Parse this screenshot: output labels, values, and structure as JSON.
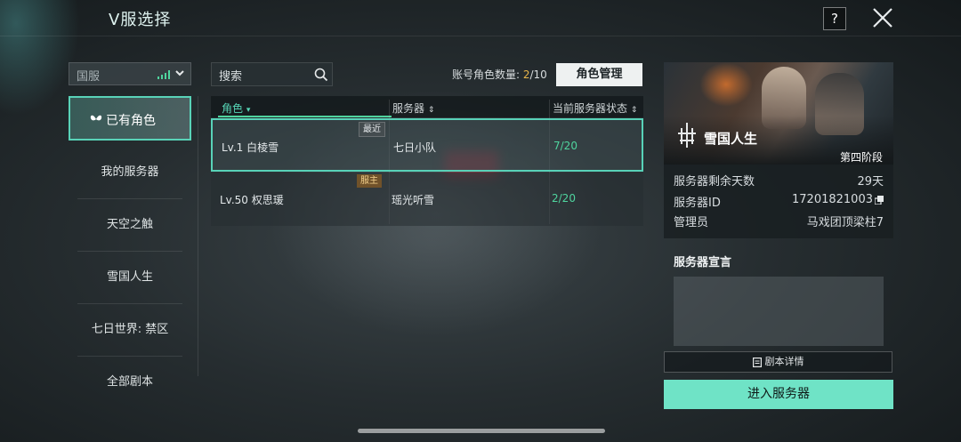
{
  "header": {
    "title": "V服选择",
    "help_label": "?"
  },
  "region_select": {
    "value": "国服"
  },
  "sidebar": {
    "items": [
      {
        "label": "已有角色",
        "selected": true
      },
      {
        "label": "我的服务器"
      },
      {
        "label": "天空之触"
      },
      {
        "label": "雪国人生"
      },
      {
        "label": "七日世界: 禁区"
      },
      {
        "label": "全部剧本"
      }
    ]
  },
  "search": {
    "placeholder": "搜索"
  },
  "account": {
    "label": "账号角色数量: ",
    "current": "2",
    "sep": "/10"
  },
  "manage_button": "角色管理",
  "table": {
    "headers": [
      "角色",
      "服务器",
      "当前服务器状态"
    ],
    "rows": [
      {
        "tag": "最近",
        "name": "Lv.1 白棱雪",
        "server": "七日小队",
        "status": "7/20"
      },
      {
        "tag": "服主",
        "name": "Lv.50 权思瑗",
        "server": "瑶光听雪",
        "status": "2/20"
      }
    ]
  },
  "server_card": {
    "name": "雪国人生",
    "stage": "第四阶段",
    "details": [
      {
        "label": "服务器剩余天数",
        "value": "29天"
      },
      {
        "label": "服务器ID",
        "value": "17201821003"
      },
      {
        "label": "管理员",
        "value": "马戏团顶梁柱7"
      }
    ]
  },
  "declaration": {
    "title": "服务器宣言"
  },
  "script_detail_button": "剧本详情",
  "enter_button": "进入服务器",
  "colors": {
    "accent": "#59d3b8",
    "status_green": "#4fd49e",
    "highlight": "#e7b64a"
  }
}
